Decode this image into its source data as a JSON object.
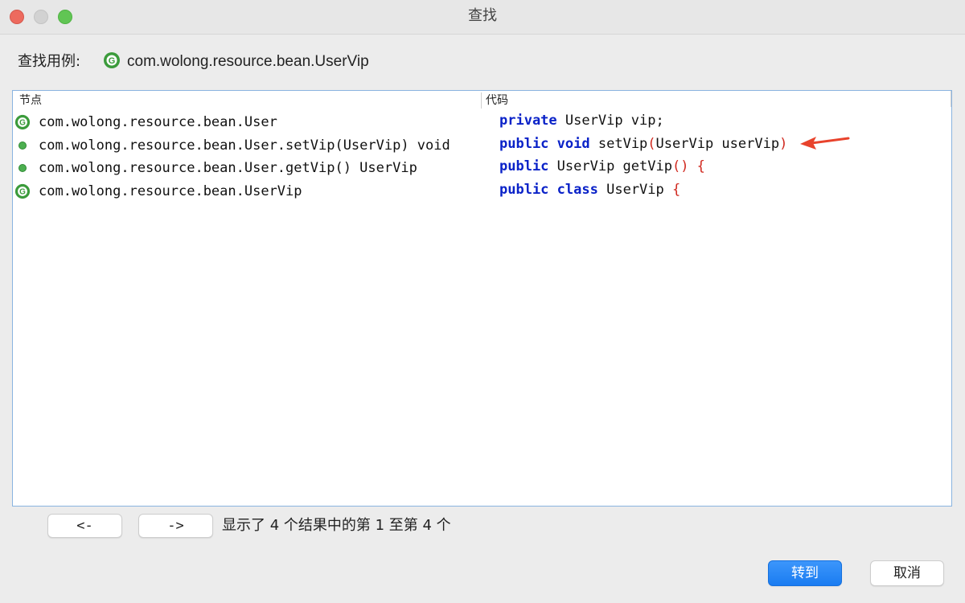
{
  "window": {
    "title": "查找",
    "controls": [
      "close",
      "minimize",
      "maximize"
    ]
  },
  "search": {
    "label": "查找用例:",
    "icon": "class-g-icon",
    "target": "com.wolong.resource.bean.UserVip"
  },
  "results": {
    "columns": {
      "node": "节点",
      "code": "代码"
    },
    "rows": [
      {
        "icon": "class-g-icon",
        "node": "com.wolong.resource.bean.User",
        "code": {
          "kw1": "private",
          "kw2": "",
          "rest": "UserVip vip;",
          "tail": ""
        }
      },
      {
        "icon": "method-dot-icon",
        "node": "com.wolong.resource.bean.User.setVip(UserVip) void",
        "code": {
          "kw1": "public",
          "kw2": "void",
          "name": "setVip",
          "open": "(",
          "args": "UserVip userVip",
          "close": ")"
        }
      },
      {
        "icon": "method-dot-icon",
        "node": "com.wolong.resource.bean.User.getVip() UserVip",
        "code": {
          "kw1": "public",
          "kw2": "",
          "rest": "UserVip getVip",
          "tail": "() {"
        }
      },
      {
        "icon": "class-g-icon",
        "node": "com.wolong.resource.bean.UserVip",
        "code": {
          "kw1": "public",
          "kw2": "class",
          "rest": "UserVip",
          "tail": "{"
        }
      }
    ]
  },
  "navigation": {
    "prev_label": "<-",
    "next_label": "->",
    "status": "显示了 4 个结果中的第 1 至第 4 个"
  },
  "actions": {
    "goto_label": "转到",
    "cancel_label": "取消"
  },
  "colors": {
    "keyword": "#0a22c8",
    "bracket": "#d0271d",
    "class_icon": "#3b9b3b",
    "accent_button": "#1a7cf1",
    "annotation_arrow": "#e8432c"
  }
}
